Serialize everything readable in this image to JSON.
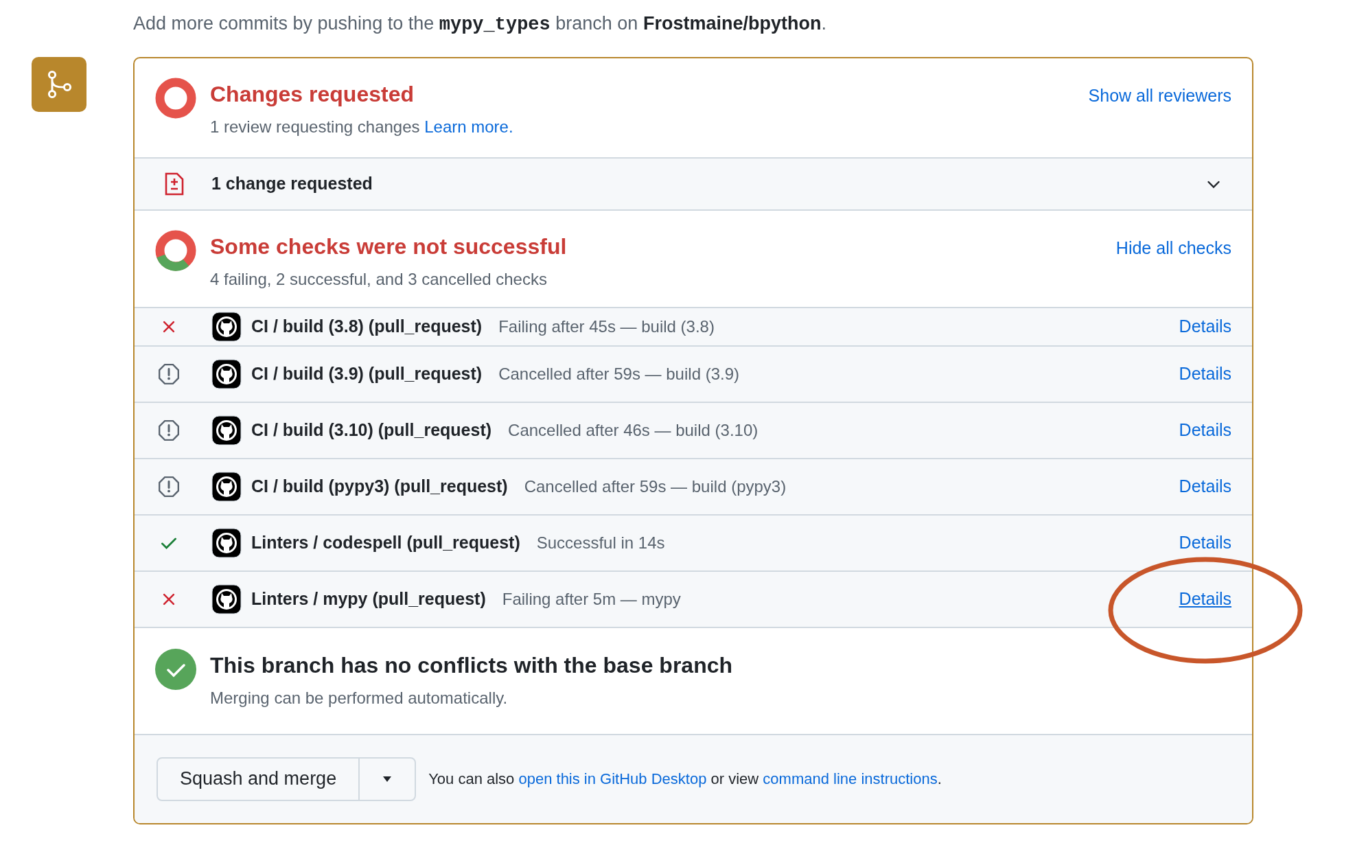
{
  "intro": {
    "text": "Add more commits by pushing to the",
    "branch": "mypy_types",
    "middle": "branch on",
    "repo": "Frostmaine/bpython",
    "end": "."
  },
  "review": {
    "title": "Changes requested",
    "subtitle": "1 review requesting changes",
    "link": "Learn more.",
    "action": "Show all reviewers"
  },
  "changes_row": {
    "label": "1 change requested",
    "expanded": false
  },
  "checks": {
    "title": "Some checks were not successful",
    "subtitle": "4 failing, 2 successful, and 3 cancelled checks",
    "action": "Hide all checks",
    "items": [
      {
        "kind": "failing",
        "name": "CI / build (3.8) (pull_request)",
        "detail": "Failing after 45s — build (3.8)",
        "link": "Details",
        "hovered": false
      },
      {
        "kind": "cancelled",
        "name": "CI / build (3.9) (pull_request)",
        "detail": "Cancelled after 59s — build (3.9)",
        "link": "Details",
        "hovered": false
      },
      {
        "kind": "cancelled",
        "name": "CI / build (3.10) (pull_request)",
        "detail": "Cancelled after 46s — build (3.10)",
        "link": "Details",
        "hovered": false
      },
      {
        "kind": "cancelled",
        "name": "CI / build (pypy3) (pull_request)",
        "detail": "Cancelled after 59s — build (pypy3)",
        "link": "Details",
        "hovered": false
      },
      {
        "kind": "success",
        "name": "Linters / codespell (pull_request)",
        "detail": "Successful in 14s",
        "link": "Details",
        "hovered": false
      },
      {
        "kind": "failing",
        "name": "Linters / mypy (pull_request)",
        "detail": "Failing after 5m — mypy",
        "link": "Details",
        "hovered": true,
        "circled": true
      }
    ]
  },
  "conflicts": {
    "title": "This branch has no conflicts with the base branch",
    "subtitle": "Merging can be performed automatically."
  },
  "merge": {
    "button": "Squash and merge",
    "text_before": "You can also",
    "link1": "open this in GitHub Desktop",
    "text_middle": "or view",
    "link2": "command line instructions",
    "text_end": "."
  }
}
